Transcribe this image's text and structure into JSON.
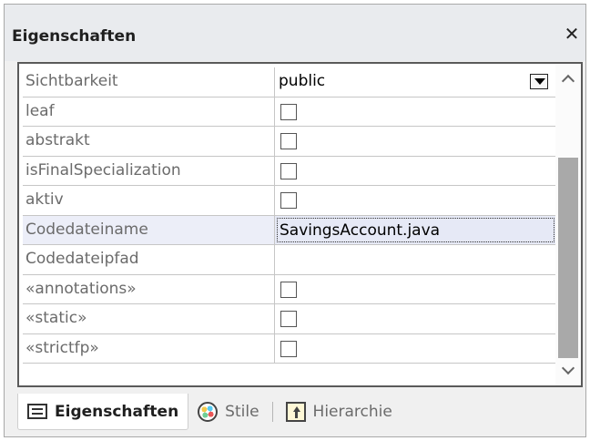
{
  "window": {
    "title": "Eigenschaften",
    "close_label": "✕"
  },
  "properties": [
    {
      "name": "Sichtbarkeit",
      "type": "dropdown",
      "value": "public"
    },
    {
      "name": "leaf",
      "type": "checkbox",
      "checked": false
    },
    {
      "name": "abstrakt",
      "type": "checkbox",
      "checked": false
    },
    {
      "name": "isFinalSpecialization",
      "type": "checkbox",
      "checked": false
    },
    {
      "name": "aktiv",
      "type": "checkbox",
      "checked": false
    },
    {
      "name": "Codedateiname",
      "type": "text",
      "value": "SavingsAccount.java",
      "selected": true
    },
    {
      "name": "Codedateipfad",
      "type": "text",
      "value": ""
    },
    {
      "name": "«annotations»",
      "type": "checkbox",
      "checked": false
    },
    {
      "name": "«static»",
      "type": "checkbox",
      "checked": false
    },
    {
      "name": "«strictfp»",
      "type": "checkbox",
      "checked": false
    }
  ],
  "tabs": [
    {
      "label": "Eigenschaften",
      "icon": "properties-icon",
      "active": true
    },
    {
      "label": "Stile",
      "icon": "palette-icon",
      "active": false
    },
    {
      "label": "Hierarchie",
      "icon": "hierarchy-icon",
      "active": false
    }
  ]
}
